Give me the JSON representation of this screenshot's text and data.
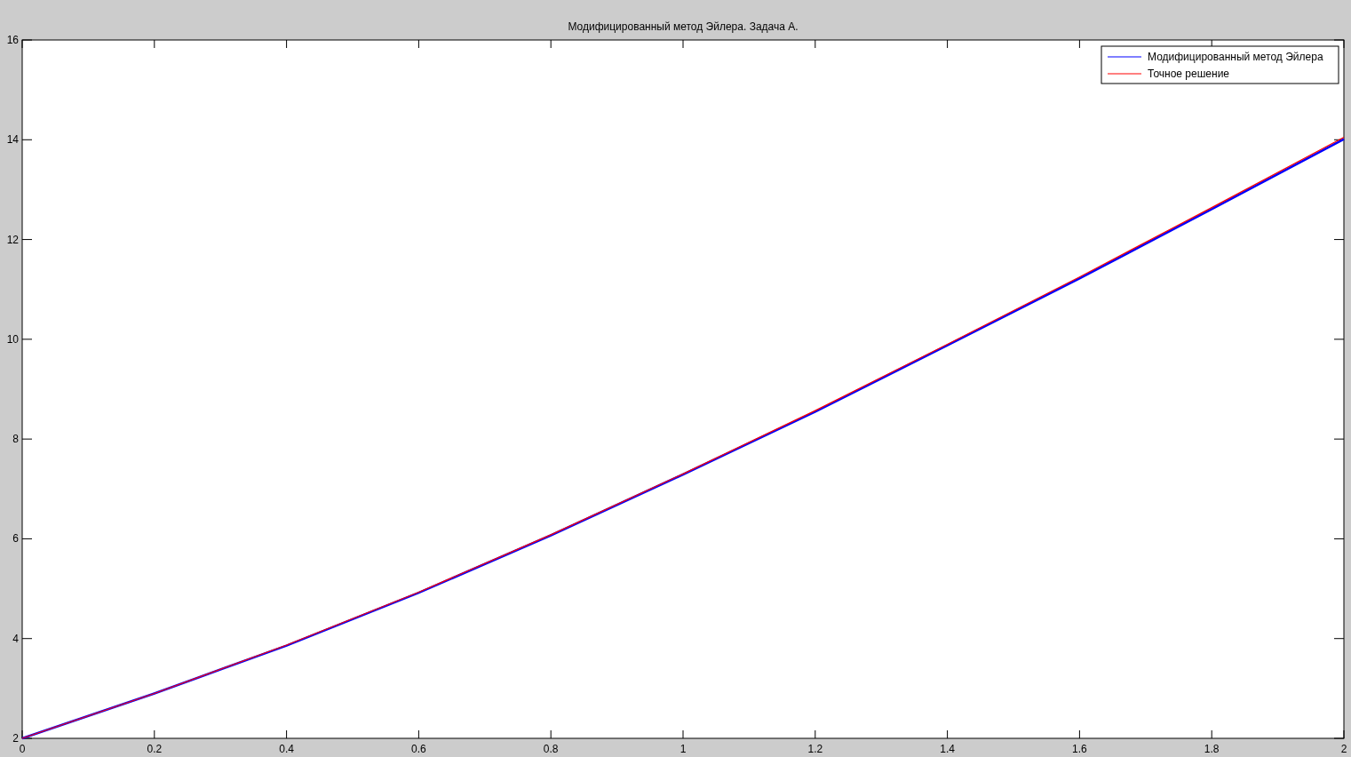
{
  "figure": {
    "chart_data": {
      "type": "line",
      "title": "Модифицированный метод Эйлера. Задача А.",
      "x": [
        0,
        0.2,
        0.4,
        0.6,
        0.8,
        1,
        1.2,
        1.4,
        1.6,
        1.8,
        2
      ],
      "series": [
        {
          "name": "Модифицированный метод Эйлера",
          "color": "#0000ff",
          "values": [
            2,
            2.9,
            3.86,
            4.92,
            6.07,
            7.29,
            8.55,
            9.88,
            11.22,
            12.61,
            14.01
          ]
        },
        {
          "name": "Точное решение",
          "color": "#ff0000",
          "values": [
            2,
            2.9,
            3.87,
            4.93,
            6.08,
            7.3,
            8.57,
            9.9,
            11.25,
            12.64,
            14.05
          ]
        }
      ],
      "legend": "upper right",
      "xlim": [
        0,
        2
      ],
      "ylim": [
        2,
        16
      ],
      "xticks": [
        0,
        0.2,
        0.4,
        0.6,
        0.8,
        1,
        1.2,
        1.4,
        1.6,
        1.8,
        2
      ],
      "yticks": [
        2,
        4,
        6,
        8,
        10,
        12,
        14,
        16
      ]
    }
  }
}
